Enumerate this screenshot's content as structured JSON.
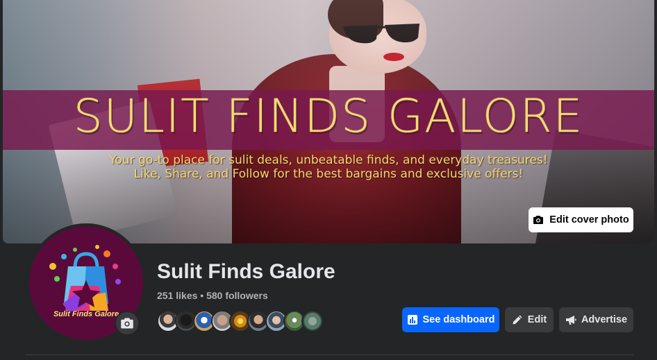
{
  "cover": {
    "title": "SULIT FINDS GALORE",
    "tagline_line1": "Your go-to place for sulit deals, unbeatable finds, and everyday treasures!",
    "tagline_line2": "Like, Share, and Follow for the best bargains and exclusive offers!",
    "edit_button_label": "Edit cover photo",
    "edit_button_icon": "camera-icon"
  },
  "profile": {
    "avatar_brand_text": "Sulit Finds Galore",
    "page_name": "Sulit Finds Galore",
    "stats": "251 likes • 580 followers",
    "follower_avatar_count": 9,
    "avatar_camera_icon": "camera-icon"
  },
  "actions": {
    "dashboard_label": "See dashboard",
    "dashboard_icon": "bar-chart-icon",
    "edit_label": "Edit",
    "edit_icon": "pencil-icon",
    "advertise_label": "Advertise",
    "advertise_icon": "megaphone-icon"
  },
  "colors": {
    "background": "#242526",
    "primary_button": "#0866ff",
    "secondary_button": "#3a3b3c",
    "banner": "#78184e",
    "banner_text": "#f3dc6f",
    "avatar_bg": "#5a0a3a"
  }
}
